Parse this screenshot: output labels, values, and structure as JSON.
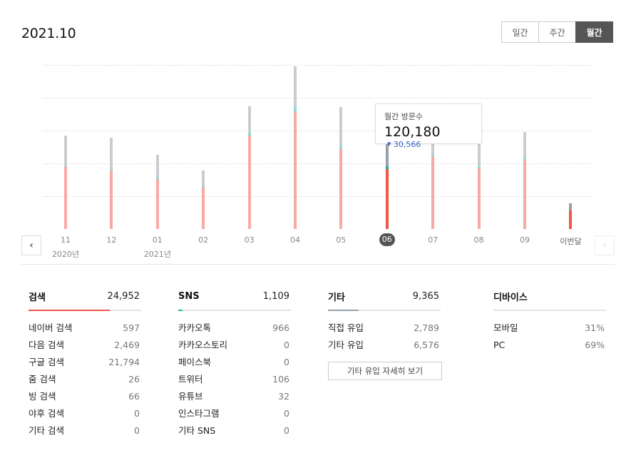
{
  "header": {
    "title": "2021.10"
  },
  "period_tabs": {
    "daily": "일간",
    "weekly": "주간",
    "monthly": "월간",
    "active": "월간"
  },
  "colors": {
    "search": "#f1574a",
    "sns": "#26b59b",
    "other": "#98a0ab",
    "search_light": "#f7aaa4",
    "sns_light": "#8fdcd0",
    "other_light": "#c9cdd1",
    "tooltip_delta": "#3b5cc9"
  },
  "chart_data": {
    "type": "bar",
    "stacked": true,
    "categories": [
      "11",
      "12",
      "01",
      "02",
      "03",
      "04",
      "05",
      "06",
      "07",
      "08",
      "09",
      "이번달"
    ],
    "year_labels": [
      "2020년",
      "2021년"
    ],
    "year_label_categories": [
      "11",
      "01"
    ],
    "series": [
      {
        "values": [
          79000,
          75000,
          64000,
          54000,
          120000,
          150000,
          102000,
          77000,
          93000,
          78000,
          89000,
          24000
        ]
      },
      {
        "values": [
          1500,
          1500,
          1500,
          1000,
          3000,
          6000,
          4000,
          3000,
          2500,
          2000,
          2500,
          0
        ]
      },
      {
        "values": [
          39500,
          40000,
          29500,
          20000,
          34000,
          52000,
          50000,
          40180,
          43000,
          31000,
          33000,
          9000
        ]
      }
    ],
    "ylim": [
      0,
      210000
    ],
    "grid": true,
    "selected_category": "06"
  },
  "tooltip": {
    "label": "월간 방문수",
    "value": "120,180",
    "delta_arrow": "▼",
    "delta": "30,566"
  },
  "nav": {
    "prev_icon": "chevron-left-icon",
    "next_icon": "chevron-right-icon",
    "prev": "‹",
    "next": "›"
  },
  "stats": {
    "search": {
      "title": "검색",
      "total": "24,952",
      "share": 0.72,
      "rows": [
        {
          "name": "네이버 검색",
          "value": "597"
        },
        {
          "name": "다음 검색",
          "value": "2,469"
        },
        {
          "name": "구글 검색",
          "value": "21,794"
        },
        {
          "name": "줌 검색",
          "value": "26"
        },
        {
          "name": "빙 검색",
          "value": "66"
        },
        {
          "name": "야후 검색",
          "value": "0"
        },
        {
          "name": "기타 검색",
          "value": "0"
        }
      ]
    },
    "sns": {
      "title": "SNS",
      "total": "1,109",
      "share": 0.04,
      "rows": [
        {
          "name": "카카오톡",
          "value": "966"
        },
        {
          "name": "카카오스토리",
          "value": "0"
        },
        {
          "name": "페이스북",
          "value": "0"
        },
        {
          "name": "트위터",
          "value": "106"
        },
        {
          "name": "유튜브",
          "value": "32"
        },
        {
          "name": "인스타그램",
          "value": "0"
        },
        {
          "name": "기타 SNS",
          "value": "0"
        }
      ]
    },
    "other": {
      "title": "기타",
      "total": "9,365",
      "share": 0.27,
      "rows": [
        {
          "name": "직접 유입",
          "value": "2,789"
        },
        {
          "name": "기타 유입",
          "value": "6,576"
        }
      ],
      "detail_button": "기타 유입 자세히 보기"
    },
    "device": {
      "title": "디바이스",
      "rows": [
        {
          "name": "모바일",
          "value": "31%"
        },
        {
          "name": "PC",
          "value": "69%"
        }
      ]
    }
  }
}
